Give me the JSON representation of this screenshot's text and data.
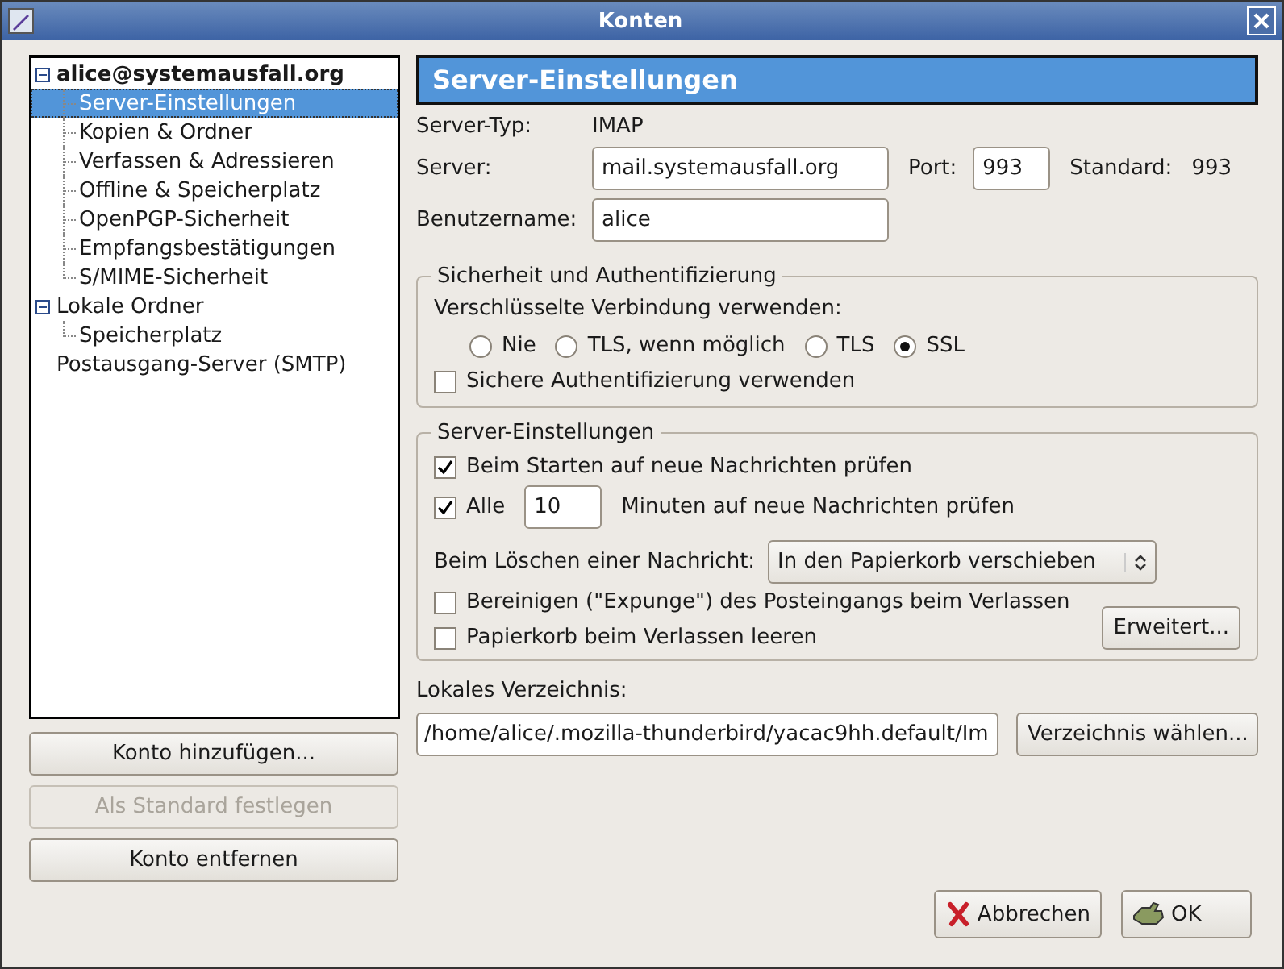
{
  "window": {
    "title": "Konten"
  },
  "tree": [
    {
      "label": "alice@systemausfall.org",
      "bold": true,
      "expanded": true,
      "selected": false,
      "children": [
        {
          "label": "Server-Einstellungen",
          "selected": true
        },
        {
          "label": "Kopien & Ordner",
          "selected": false
        },
        {
          "label": "Verfassen & Adressieren",
          "selected": false
        },
        {
          "label": "Offline & Speicherplatz",
          "selected": false
        },
        {
          "label": "OpenPGP-Sicherheit",
          "selected": false
        },
        {
          "label": "Empfangsbestätigungen",
          "selected": false
        },
        {
          "label": "S/MIME-Sicherheit",
          "selected": false
        }
      ]
    },
    {
      "label": "Lokale Ordner",
      "bold": false,
      "expanded": true,
      "selected": false,
      "children": [
        {
          "label": "Speicherplatz",
          "selected": false
        }
      ]
    },
    {
      "label": "Postausgang-Server (SMTP)",
      "bold": false,
      "selected": false
    }
  ],
  "account_buttons": [
    {
      "label": "Konto hinzufügen...",
      "disabled": false
    },
    {
      "label": "Als Standard festlegen",
      "disabled": true
    },
    {
      "label": "Konto entfernen",
      "disabled": false
    }
  ],
  "header": "Server-Einstellungen",
  "server_type": {
    "label": "Server-Typ:",
    "value": "IMAP"
  },
  "server": {
    "label": "Server:",
    "value": "mail.systemausfall.org"
  },
  "port": {
    "label": "Port:",
    "value": "993"
  },
  "default_port": {
    "label": "Standard:",
    "value": "993"
  },
  "username": {
    "label": "Benutzername:",
    "value": "alice"
  },
  "security": {
    "title": "Sicherheit und Authentifizierung",
    "prompt": "Verschlüsselte Verbindung verwenden:",
    "options": [
      {
        "label": "Nie",
        "selected": false
      },
      {
        "label": "TLS, wenn möglich",
        "selected": false
      },
      {
        "label": "TLS",
        "selected": false
      },
      {
        "label": "SSL",
        "selected": true
      }
    ],
    "secure_auth": {
      "label": "Sichere Authentifizierung verwenden",
      "checked": false
    }
  },
  "server_settings": {
    "title": "Server-Einstellungen",
    "check_on_start": {
      "label": "Beim Starten auf neue Nachrichten prüfen",
      "checked": true
    },
    "check_every": {
      "label": "Alle",
      "checked": true,
      "value": "10",
      "suffix": "Minuten auf neue Nachrichten prüfen"
    },
    "on_delete": {
      "label": "Beim Löschen einer Nachricht:",
      "value": "In den Papierkorb verschieben"
    },
    "expunge": {
      "label": "Bereinigen (\"Expunge\") des Posteingangs beim Verlassen",
      "checked": false
    },
    "empty_trash": {
      "label": "Papierkorb beim Verlassen leeren",
      "checked": false
    },
    "advanced_button": "Erweitert..."
  },
  "local_dir": {
    "label": "Lokales Verzeichnis:",
    "value": "/home/alice/.mozilla-thunderbird/yacac9hh.default/Im",
    "button": "Verzeichnis wählen..."
  },
  "dialog_buttons": [
    {
      "kind": "cancel",
      "label": "Abbrechen"
    },
    {
      "kind": "ok",
      "label": "OK"
    }
  ]
}
